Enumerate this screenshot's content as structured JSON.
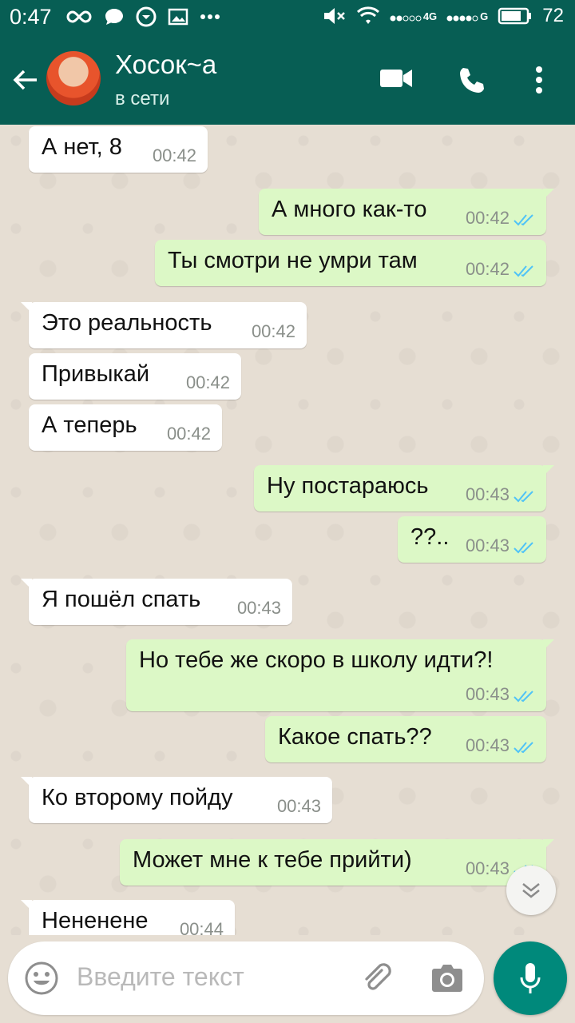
{
  "status_bar": {
    "time": "0:47",
    "battery": "72",
    "signal_label_1": "4G",
    "signal_label_2": "G"
  },
  "header": {
    "contact_name": "Хосок~а",
    "contact_status": "в сети"
  },
  "messages": [
    {
      "dir": "in",
      "text": "А нет, 8",
      "time": "00:42"
    },
    {
      "dir": "out",
      "text": "А много как-то",
      "time": "00:42",
      "status": "read"
    },
    {
      "dir": "out",
      "text": "Ты смотри не умри там",
      "time": "00:42",
      "status": "read"
    },
    {
      "dir": "in",
      "text": "Это реальность",
      "time": "00:42"
    },
    {
      "dir": "in",
      "text": "Привыкай",
      "time": "00:42"
    },
    {
      "dir": "in",
      "text": "А теперь",
      "time": "00:42"
    },
    {
      "dir": "out",
      "text": "Ну постараюсь",
      "time": "00:43",
      "status": "read"
    },
    {
      "dir": "out",
      "text": "??..",
      "time": "00:43",
      "status": "read"
    },
    {
      "dir": "in",
      "text": "Я пошёл спать",
      "time": "00:43"
    },
    {
      "dir": "out",
      "text": "Но тебе же скоро в школу идти?!",
      "time": "00:43",
      "status": "read"
    },
    {
      "dir": "out",
      "text": "Какое спать??",
      "time": "00:43",
      "status": "read"
    },
    {
      "dir": "in",
      "text": "Ко второму пойду",
      "time": "00:43"
    },
    {
      "dir": "out",
      "text": "Может мне к тебе прийти)",
      "time": "00:43",
      "status": "read"
    },
    {
      "dir": "in",
      "text": "Нененене",
      "time": "00:44"
    }
  ],
  "input": {
    "placeholder": "Введите текст"
  },
  "colors": {
    "header": "#075e54",
    "outgoing_bubble": "#dcf8c6",
    "incoming_bubble": "#ffffff",
    "read_ticks": "#4fc3f7",
    "mic_button": "#00897b"
  }
}
